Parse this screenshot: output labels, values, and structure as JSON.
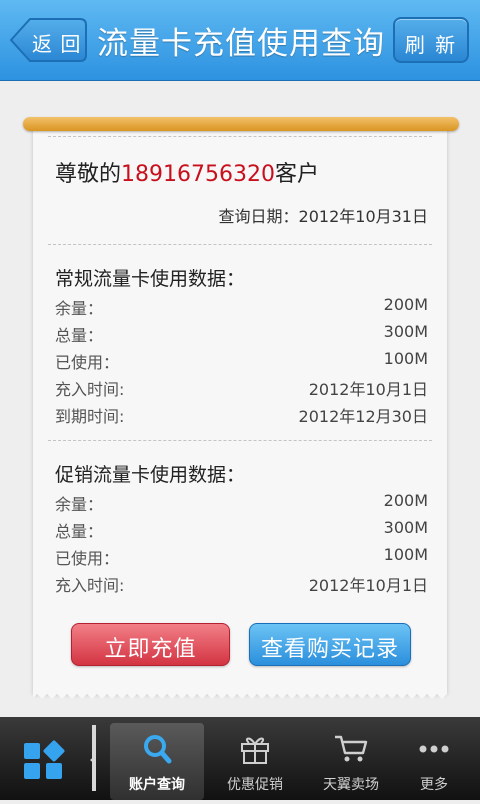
{
  "header": {
    "back_label": "返 回",
    "title": "流量卡充值使用查询",
    "refresh_label": "刷 新"
  },
  "receipt": {
    "greeting_prefix": "尊敬的",
    "phone": "18916756320",
    "greeting_suffix": "客户",
    "query_date": "查询日期：2012年10月31日",
    "regular": {
      "title": "常规流量卡使用数据：",
      "rows": [
        {
          "label": "余量：",
          "value": "200M"
        },
        {
          "label": "总量：",
          "value": "300M"
        },
        {
          "label": "已使用：",
          "value": "100M"
        },
        {
          "label": "充入时间:",
          "value": "2012年10月1日"
        },
        {
          "label": "到期时间:",
          "value": "2012年12月30日"
        }
      ]
    },
    "promo": {
      "title": "促销流量卡使用数据：",
      "rows": [
        {
          "label": "余量：",
          "value": "200M"
        },
        {
          "label": "总量：",
          "value": "300M"
        },
        {
          "label": "已使用：",
          "value": "100M"
        },
        {
          "label": "充入时间:",
          "value": "2012年10月1日"
        }
      ]
    },
    "recharge_label": "立即充值",
    "history_label": "查看购买记录"
  },
  "tabs": [
    {
      "label": "账户查询",
      "icon": "search-icon",
      "active": true
    },
    {
      "label": "优惠促销",
      "icon": "gift-icon",
      "active": false
    },
    {
      "label": "天翼卖场",
      "icon": "cart-icon",
      "active": false
    },
    {
      "label": "更多",
      "icon": "more-icon",
      "active": false
    }
  ],
  "colors": {
    "header_blue": "#2d92e0",
    "phone_red": "#c8101d",
    "recharge_red": "#d33442",
    "history_blue": "#2b8fdc",
    "roller_gold": "#e4a333"
  }
}
